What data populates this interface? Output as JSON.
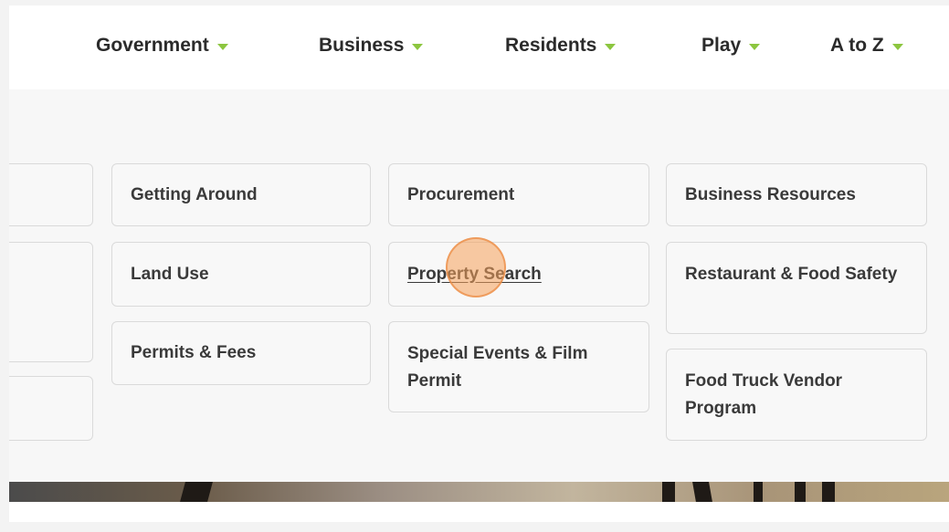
{
  "colors": {
    "caret": "#8cc63f",
    "card_border": "#dadada",
    "text": "#2b2b2b",
    "cursor": "#f5a05a"
  },
  "nav": {
    "items": [
      {
        "label": "Government",
        "icon": "chevron-down-icon"
      },
      {
        "label": "Business",
        "icon": "chevron-down-icon"
      },
      {
        "label": "Residents",
        "icon": "chevron-down-icon"
      },
      {
        "label": "Play",
        "icon": "chevron-down-icon"
      },
      {
        "label": "A to Z",
        "icon": "chevron-down-icon"
      }
    ]
  },
  "menu": {
    "col2": [
      "Getting Around",
      "Land Use",
      "Permits & Fees"
    ],
    "col3": [
      "Procurement",
      "Property Search",
      "Special Events & Film Permit"
    ],
    "col4": [
      "Business Resources",
      "Restaurant & Food Safety",
      "Food Truck Vendor Program"
    ]
  }
}
